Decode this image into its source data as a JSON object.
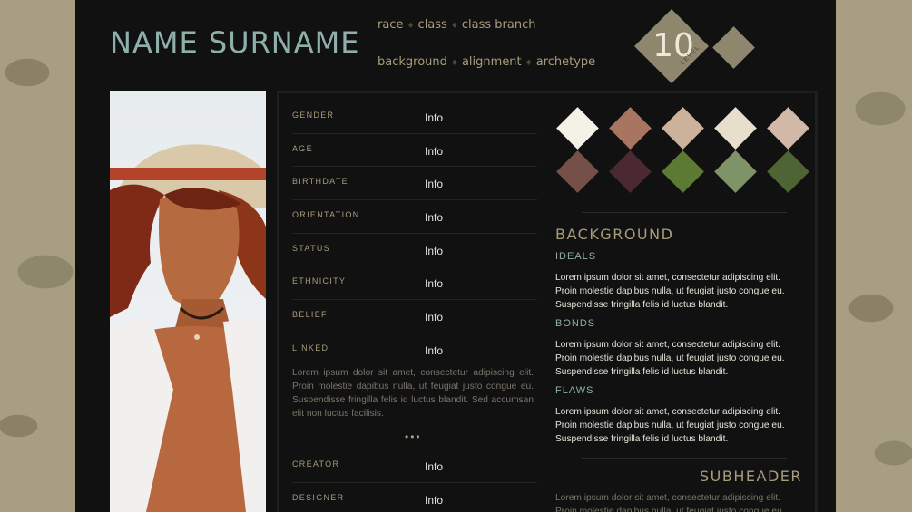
{
  "header": {
    "name": "NAME SURNAME",
    "meta_row1": [
      "race",
      "class",
      "class branch"
    ],
    "meta_row2": [
      "background",
      "alignment",
      "archetype"
    ],
    "level_number": "10",
    "level_label": "LEVEL"
  },
  "info_rows": [
    {
      "label": "GENDER",
      "value": "Info"
    },
    {
      "label": "AGE",
      "value": "Info"
    },
    {
      "label": "BIRTHDATE",
      "value": "Info"
    },
    {
      "label": "ORIENTATION",
      "value": "Info"
    },
    {
      "label": "STATUS",
      "value": "Info"
    },
    {
      "label": "ETHNICITY",
      "value": "Info"
    },
    {
      "label": "BELIEF",
      "value": "Info"
    },
    {
      "label": "LINKED",
      "value": "Info"
    }
  ],
  "description": "Lorem ipsum dolor sit amet, consectetur adipiscing elit. Proin molestie dapibus nulla, ut feugiat justo congue eu. Suspendisse fringilla felis id luctus blandit. Sed accumsan elit non luctus facilisis.",
  "dots": "•••",
  "credit_rows": [
    {
      "label": "CREATOR",
      "value": "Info"
    },
    {
      "label": "DESIGNER",
      "value": "Info"
    }
  ],
  "palette": [
    "#f4f1e6",
    "#a87660",
    "#ccb29a",
    "#e7decb",
    "#d2b8a6",
    "#755048",
    "#4a2a30",
    "#5c7a34",
    "#7f9466",
    "#4f6434"
  ],
  "background_section": {
    "title": "BACKGROUND",
    "ideals_label": "IDEALS",
    "ideals_text": "Lorem ipsum dolor sit amet, consectetur adipiscing elit. Proin molestie dapibus nulla, ut feugiat justo congue eu. Suspendisse fringilla felis id luctus blandit.",
    "bonds_label": "BONDS",
    "bonds_text": "Lorem ipsum dolor sit amet, consectetur adipiscing elit. Proin molestie dapibus nulla, ut feugiat justo congue eu. Suspendisse fringilla felis id luctus blandit.",
    "flaws_label": "FLAWS",
    "flaws_text": "Lorem ipsum dolor sit amet, consectetur adipiscing elit. Proin molestie dapibus nulla, ut feugiat justo congue eu. Suspendisse fringilla felis id luctus blandit."
  },
  "subheader_section": {
    "title": "SUBHEADER",
    "text": "Lorem ipsum dolor sit amet, consectetur adipiscing elit. Proin molestie dapibus nulla, ut feugiat justo congue eu."
  }
}
